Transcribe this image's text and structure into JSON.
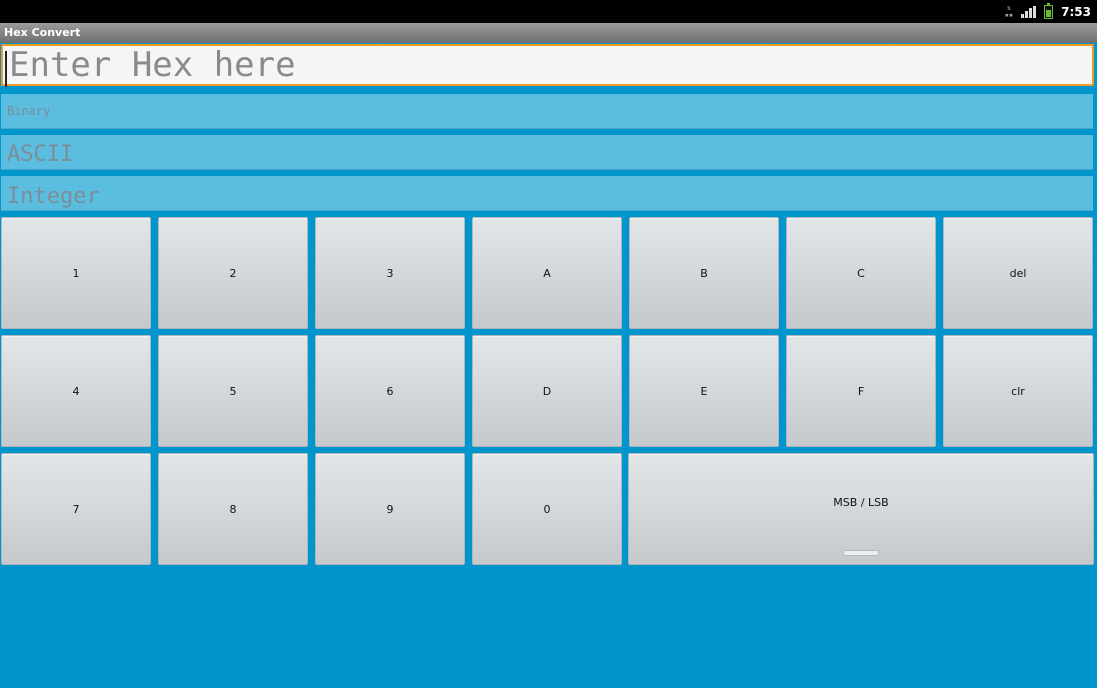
{
  "status_bar": {
    "time": "7:53",
    "network_icon": "data-transfer-icon",
    "signal_icon": "signal-bars-icon",
    "battery_icon": "battery-icon"
  },
  "app": {
    "title": "Hex Convert"
  },
  "hex_input": {
    "placeholder": "Enter Hex here",
    "value": ""
  },
  "outputs": {
    "binary": "Binary",
    "ascii": "ASCII",
    "integer": "Integer"
  },
  "keypad": {
    "row1": [
      "1",
      "2",
      "3",
      "A",
      "B",
      "C",
      "del"
    ],
    "row2": [
      "4",
      "5",
      "6",
      "D",
      "E",
      "F",
      "clr"
    ],
    "row3": [
      "7",
      "8",
      "9",
      "0"
    ],
    "msb_lsb": "MSB / LSB"
  },
  "colors": {
    "background": "#0095cc",
    "field": "#5bbde0",
    "input_border": "#f39b1e",
    "key": "#d6d9dc"
  }
}
